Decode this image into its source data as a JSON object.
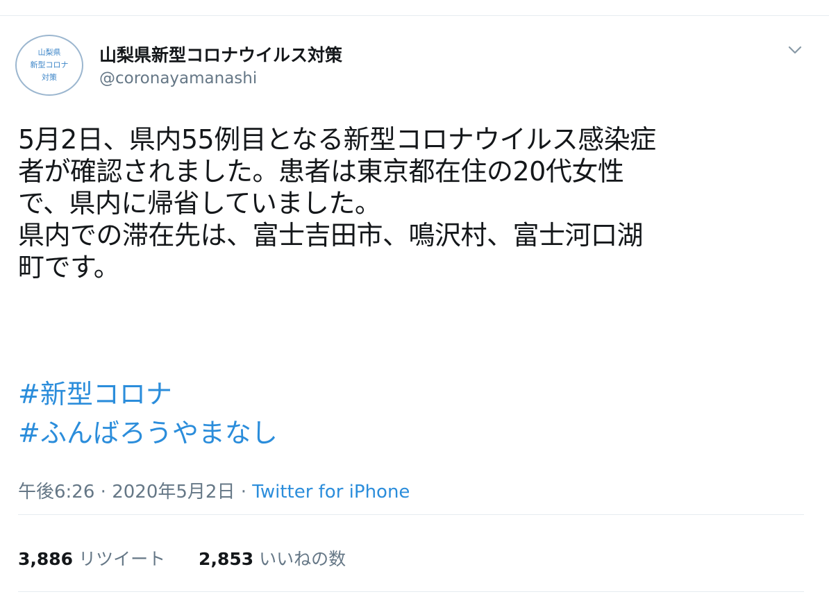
{
  "author": {
    "avatar_lines": [
      "山梨県",
      "新型コロナ",
      "対策"
    ],
    "display_name": "山梨県新型コロナウイルス対策",
    "handle": "@coronayamanashi"
  },
  "tweet": {
    "body": "5月2日、県内55例目となる新型コロナウイルス感染症\n者が確認されました。患者は東京都在住の20代女性\nで、県内に帰省していました。\n県内での滞在先は、富士吉田市、鳴沢村、富士河口湖\n町です。",
    "hashtags": [
      "#新型コロナ",
      "#ふんばろうやまなし"
    ],
    "time": "午後6:26",
    "separator": "·",
    "date": "2020年5月2日",
    "source": "Twitter for iPhone"
  },
  "stats": {
    "retweets_count": "3,886",
    "retweets_label": "リツイート",
    "likes_count": "2,853",
    "likes_label": "いいねの数"
  },
  "icons": {
    "more": "chevron-down-icon"
  },
  "colors": {
    "link": "#2b8ddb",
    "secondary_text": "#657786",
    "avatar_ring": "#9bb6cf"
  }
}
